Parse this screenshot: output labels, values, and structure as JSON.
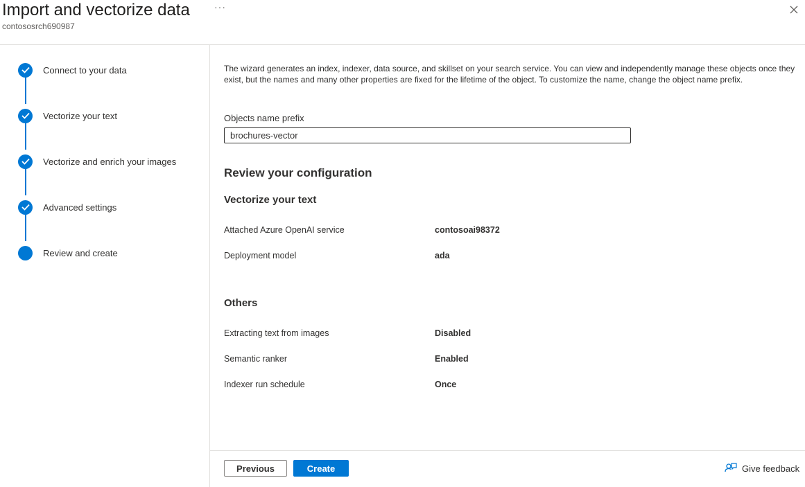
{
  "header": {
    "title": "Import and vectorize data",
    "more_label": "···",
    "subtitle": "contososrch690987"
  },
  "steps": [
    {
      "label": "Connect to your data",
      "status": "completed"
    },
    {
      "label": "Vectorize your text",
      "status": "completed"
    },
    {
      "label": "Vectorize and enrich your images",
      "status": "completed"
    },
    {
      "label": "Advanced settings",
      "status": "completed"
    },
    {
      "label": "Review and create",
      "status": "current"
    }
  ],
  "main": {
    "intro": "The wizard generates an index, indexer, data source, and skillset on your search service. You can view and independently manage these objects once they exist, but the names and many other properties are fixed for the lifetime of the object. To customize the name, change the object name prefix.",
    "prefix_label": "Objects name prefix",
    "prefix_value": "brochures-vector",
    "review_heading": "Review your configuration",
    "sections": [
      {
        "heading": "Vectorize your text",
        "rows": [
          {
            "label": "Attached Azure OpenAI service",
            "value": "contosoai98372"
          },
          {
            "label": "Deployment model",
            "value": "ada"
          }
        ]
      },
      {
        "heading": "Others",
        "rows": [
          {
            "label": "Extracting text from images",
            "value": "Disabled"
          },
          {
            "label": "Semantic ranker",
            "value": "Enabled"
          },
          {
            "label": "Indexer run schedule",
            "value": "Once"
          }
        ]
      }
    ]
  },
  "footer": {
    "previous_label": "Previous",
    "create_label": "Create",
    "feedback_label": "Give feedback"
  },
  "colors": {
    "accent": "#0078d4",
    "border": "#e1dfdd",
    "text": "#323130"
  },
  "icons": {
    "close": "close-icon",
    "step_done": "checkmark-icon",
    "feedback": "feedback-icon"
  }
}
